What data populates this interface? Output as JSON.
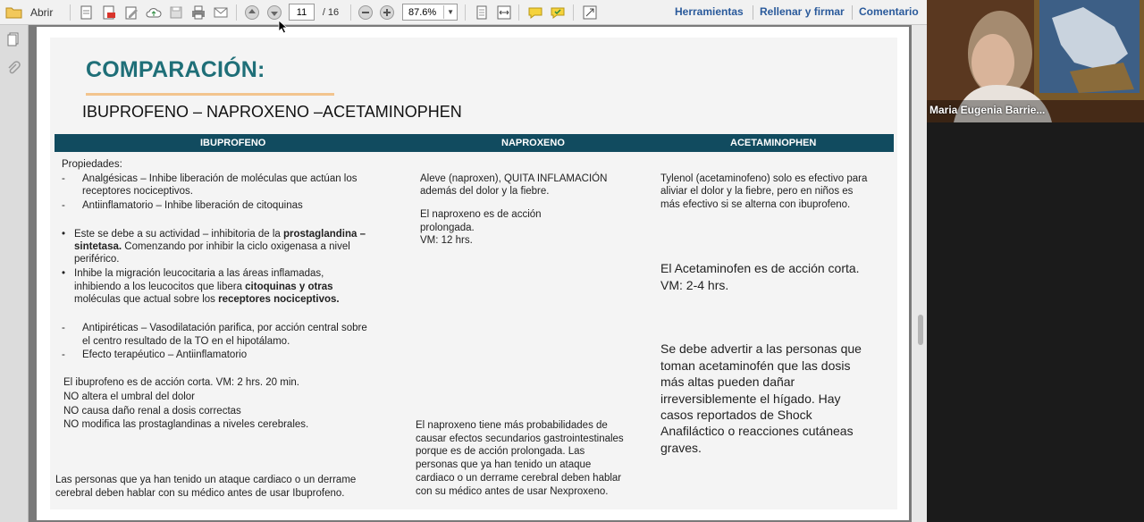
{
  "toolbar": {
    "open_label": "Abrir",
    "page_current": "11",
    "page_total": "/ 16",
    "zoom": "87.6%",
    "tools_label": "Herramientas",
    "fill_sign_label": "Rellenar y firmar",
    "comment_label": "Comentario"
  },
  "slide": {
    "title": "COMPARACIÓN:",
    "subtitle": "IBUPROFENO – NAPROXENO –ACETAMINOPHEN",
    "columns": [
      "IBUPROFENO",
      "NAPROXENO",
      "ACETAMINOPHEN"
    ],
    "ibu": {
      "props_label": "Propiedades:",
      "dash1_a": "Analgésicas – Inhibe liberación de moléculas que actúan los",
      "dash1_b": "receptores nociceptivos.",
      "dash2": "Antiinflamatorio – Inhibe liberación de citoquinas",
      "b1_pre": "Este se debe a su actividad – inhibitoria de la ",
      "b1_bold1": "prostaglandina –",
      "b1_bold2": "sintetasa.",
      "b1_post": " Comenzando por inhibir la ciclo oxigenasa a nivel",
      "b1_end": "periférico.",
      "b2_a": "Inhibe la migración leucocitaria a las áreas inflamadas,",
      "b2_pre": "inhibiendo a los leucocitos que libera ",
      "b2_bold1": "citoquinas y otras",
      "b2_mid": "moléculas que actual sobre los ",
      "b2_bold2": "receptores nociceptivos.",
      "dash3_a": "Antipiréticas – Vasodilatación parifica, por acción central sobre",
      "dash3_b": "el centro resultado de la TO en el hipotálamo.",
      "dash4": "Efecto terapéutico – Antiinflamatorio",
      "note1": "El ibuprofeno es de acción corta.  VM: 2 hrs. 20 min.",
      "note2": "NO altera el umbral del dolor",
      "note3": "NO causa daño renal a dosis correctas",
      "note4": "NO modifica las prostaglandinas a niveles cerebrales.",
      "warn_a": "Las personas que ya han tenido un ataque cardiaco o un  derrame",
      "warn_b": "cerebral deben hablar con su médico antes de  usar Ibuprofeno."
    },
    "nap": {
      "p1_a": "Aleve (naproxen), QUITA INFLAMACIÓN",
      "p1_b": "además del dolor y la  fiebre.",
      "p2_a": "El naproxeno es de acción",
      "p2_b": "prolongada.",
      "p2_c": "VM: 12 hrs.",
      "p3_a": "El naproxeno tiene más  probabilidades de",
      "p3_b": "causar efectos  secundarios gastrointestinales",
      "p3_c": "porque es de acción prolongada. Las",
      "p3_d": "personas que ya han tenido un  ataque",
      "p3_e": "cardiaco o un derrame  cerebral deben hablar",
      "p3_f": "con su médico  antes de usar Nexproxeno."
    },
    "ace": {
      "p1_a": "Tylenol (acetaminofeno) solo es  efectivo para",
      "p1_b": "aliviar el dolor y la  fiebre, pero en niños es",
      "p1_c": "más efectivo  si se alterna con ibuprofeno.",
      "p2_a": "El Acetaminofen es de acción corta.",
      "p2_b": "VM: 2-4 hrs.",
      "p3_a": "Se debe advertir a las personas que",
      "p3_b": "toman acetaminofén que las dosis",
      "p3_c": "más altas pueden dañar",
      "p3_d": "irreversiblemente el hígado. Hay",
      "p3_e": "casos reportados de Shock",
      "p3_f": "Anafiláctico o reacciones cutáneas",
      "p3_g": "graves."
    }
  },
  "video": {
    "participant_name": "Maria Eugenia Barrie..."
  },
  "colors": {
    "title_teal": "#1f6f78",
    "header_bar": "#114b5f",
    "underline": "#f2c48e",
    "link_blue": "#2a5a9b"
  }
}
